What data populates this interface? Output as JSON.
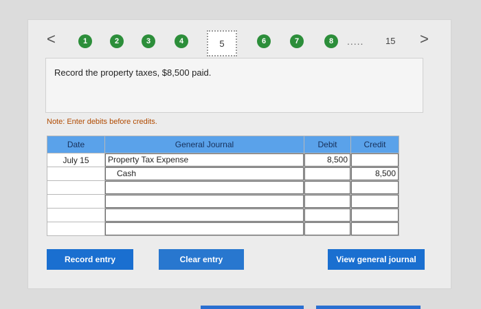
{
  "nav": {
    "prev": "<",
    "next": ">",
    "steps": [
      "1",
      "2",
      "3",
      "4",
      "5",
      "6",
      "7",
      "8"
    ],
    "ellipsis": ".....",
    "last": "15"
  },
  "question": "Record the property taxes, $8,500 paid.",
  "note": "Note: Enter debits before credits.",
  "journal": {
    "headers": {
      "date": "Date",
      "account": "General Journal",
      "debit": "Debit",
      "credit": "Credit"
    },
    "rows": [
      {
        "date": "July 15",
        "account": "Property Tax Expense",
        "debit": "8,500",
        "credit": ""
      },
      {
        "date": "",
        "account": "Cash",
        "debit": "",
        "credit": "8,500"
      },
      {
        "date": "",
        "account": "",
        "debit": "",
        "credit": ""
      },
      {
        "date": "",
        "account": "",
        "debit": "",
        "credit": ""
      },
      {
        "date": "",
        "account": "",
        "debit": "",
        "credit": ""
      },
      {
        "date": "",
        "account": "",
        "debit": "",
        "credit": ""
      }
    ]
  },
  "buttons": {
    "record": "Record entry",
    "clear": "Clear entry",
    "view": "View general journal"
  },
  "colors": {
    "step_green": "#2c8e3a",
    "header_blue": "#5aa2ea",
    "button_blue": "#1a6fd0",
    "note_orange": "#b04a00"
  }
}
